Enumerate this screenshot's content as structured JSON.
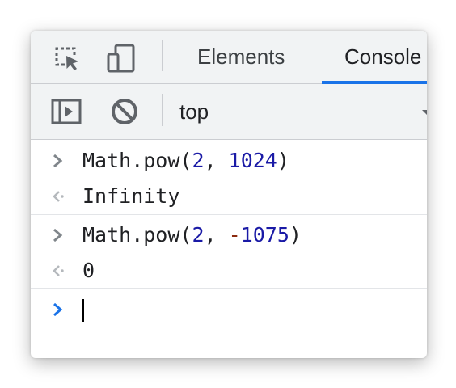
{
  "toolbar_top": {
    "inspect_icon": "inspect-element-icon",
    "device_icon": "device-toolbar-icon",
    "tabs": [
      {
        "label": "Elements",
        "active": false
      },
      {
        "label": "Console",
        "active": true
      }
    ]
  },
  "console_toolbar": {
    "sidebar_icon": "show-console-sidebar-icon",
    "clear_icon": "clear-console-icon",
    "context": "top"
  },
  "console": {
    "entries": [
      {
        "type": "input",
        "text_prefix": "Math.pow(",
        "arg1": "2",
        "sep": ", ",
        "arg2": "1024",
        "text_suffix": ")"
      },
      {
        "type": "output",
        "text": "Infinity"
      },
      {
        "type": "input",
        "text_prefix": "Math.pow(",
        "arg1": "2",
        "sep": ", ",
        "arg2_sign": "-",
        "arg2": "1075",
        "text_suffix": ")"
      },
      {
        "type": "output",
        "text": "0"
      }
    ],
    "prompt_value": ""
  },
  "colors": {
    "accent": "#1a73e8",
    "number": "#1a1aa6",
    "operator": "#8b2a0f",
    "toolbar_bg": "#f1f3f4"
  }
}
